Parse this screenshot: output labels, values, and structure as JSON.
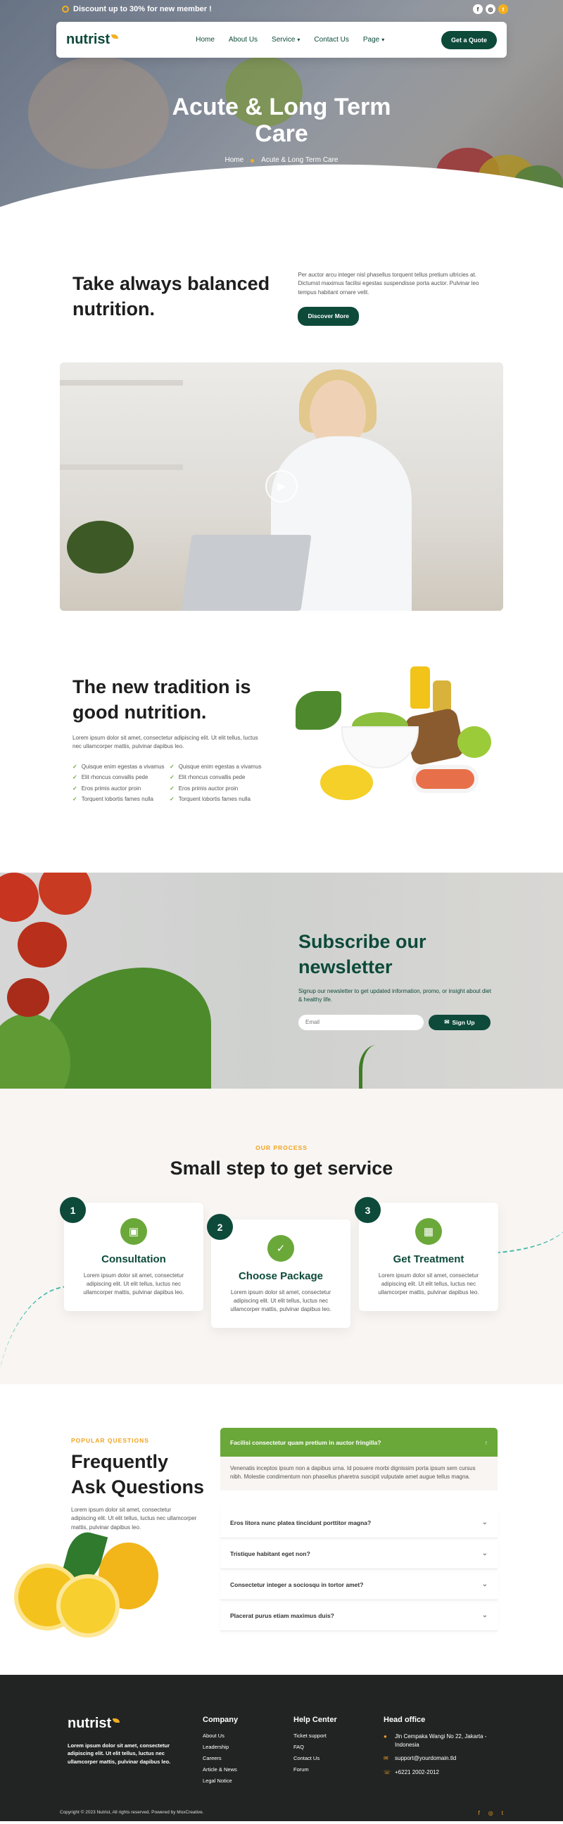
{
  "topbar": {
    "promo": "Discount up to 30% for new member !",
    "social_icons": [
      "facebook-icon",
      "instagram-icon",
      "twitter-icon"
    ],
    "social_glyphs": [
      "f",
      "◎",
      "t"
    ]
  },
  "nav": {
    "logo": "nutrist",
    "items": [
      {
        "label": "Home",
        "has_dropdown": false
      },
      {
        "label": "About Us",
        "has_dropdown": false
      },
      {
        "label": "Service",
        "has_dropdown": true
      },
      {
        "label": "Contact Us",
        "has_dropdown": false
      },
      {
        "label": "Page",
        "has_dropdown": true
      }
    ],
    "cta": "Get a Quote"
  },
  "hero": {
    "title_line1": "Acute & Long Term",
    "title_line2": "Care",
    "breadcrumb_home": "Home",
    "breadcrumb_current": "Acute & Long Term Care"
  },
  "intro": {
    "heading": "Take always balanced nutrition.",
    "text": "Per auctor arcu integer nisl phasellus torquent tellus pretium ultricies at. Dictumst maximus facilisi egestas suspendisse porta auctor. Pulvinar leo tempus habitant ornare velit.",
    "button": "Discover More"
  },
  "video": {
    "play_icon": "play-icon"
  },
  "tradition": {
    "heading": "The new tradition is good nutrition.",
    "text": "Lorem ipsum dolor sit amet, consectetur adipiscing elit. Ut elit tellus, luctus nec ullamcorper mattis, pulvinar dapibus leo.",
    "checklist": [
      "Quisque enim egestas a vivamus",
      "Quisque enim egestas a vivamus",
      "Elit rhoncus convallis pede",
      "Elit rhoncus convallis pede",
      "Eros primis auctor proin",
      "Eros primis auctor proin",
      "Torquent lobortis fames nulla",
      "Torquent lobortis fames nulla"
    ]
  },
  "newsletter": {
    "heading_line1": "Subscribe our",
    "heading_line2": "newsletter",
    "text": "Signup our newsletter to get updated information, promo, or insight about diet & healthy life.",
    "email_placeholder": "Email",
    "button": "Sign Up"
  },
  "process": {
    "eyebrow": "OUR PROCESS",
    "heading": "Small step to get service",
    "steps": [
      {
        "number": "1",
        "title": "Consultation",
        "icon": "chat-icon",
        "text": "Lorem ipsum dolor sit amet, consectetur adipiscing elit. Ut elit tellus, luctus nec ullamcorper mattis, pulvinar dapibus leo."
      },
      {
        "number": "2",
        "title": "Choose Package",
        "icon": "check-badge-icon",
        "text": "Lorem ipsum dolor sit amet, consectetur adipiscing elit. Ut elit tellus, luctus nec ullamcorper mattis, pulvinar dapibus leo."
      },
      {
        "number": "3",
        "title": "Get Treatment",
        "icon": "calendar-icon",
        "text": "Lorem ipsum dolor sit amet, consectetur adipiscing elit. Ut elit tellus, luctus nec ullamcorper mattis, pulvinar dapibus leo."
      }
    ]
  },
  "faq": {
    "eyebrow": "POPULAR QUESTIONS",
    "heading_line1": "Frequently",
    "heading_line2": "Ask Questions",
    "text": "Lorem ipsum dolor sit amet, consectetur adipiscing elit. Ut elit tellus, luctus nec ullamcorper mattis, pulvinar dapibus leo.",
    "open": {
      "question": "Facilisi consectetur quam pretium in auctor fringilla?",
      "answer": "Venenatis inceptos ipsum non a dapibus urna. Id posuere morbi dignissim porta ipsum sem cursus nibh. Molestie condimentum non phasellus pharetra suscipit vulputate amet augue tellus magna."
    },
    "items": [
      "Eros litora nunc platea tincidunt porttitor magna?",
      "Tristique habitant eget non?",
      "Consectetur integer a sociosqu in tortor amet?",
      "Placerat purus etiam maximus duis?"
    ]
  },
  "footer": {
    "logo": "nutrist",
    "about": "Lorem ipsum dolor sit amet, consectetur adipiscing elit. Ut elit tellus, luctus nec ullamcorper mattis, pulvinar dapibus leo.",
    "company": {
      "title": "Company",
      "links": [
        "About Us",
        "Leadership",
        "Careers",
        "Article & News",
        "Legal Notice"
      ]
    },
    "help": {
      "title": "Help Center",
      "links": [
        "Ticket support",
        "FAQ",
        "Contact Us",
        "Forum"
      ]
    },
    "office": {
      "title": "Head office",
      "address": "Jln Cempaka Wangi No 22, Jakarta - Indonesia",
      "email": "support@yourdomain.tld",
      "phone": "+6221 2002-2012"
    },
    "copyright": "Copyright © 2023 Nutrist, All rights reserved. Powered by MoxCreative.",
    "social_glyphs": [
      "f",
      "◎",
      "t"
    ]
  },
  "colors": {
    "primary": "#0d4a3a",
    "accent_green": "#6aa83a",
    "accent_yellow": "#f2a21e",
    "cream": "#f8f5f2",
    "footer_bg": "#222424"
  }
}
